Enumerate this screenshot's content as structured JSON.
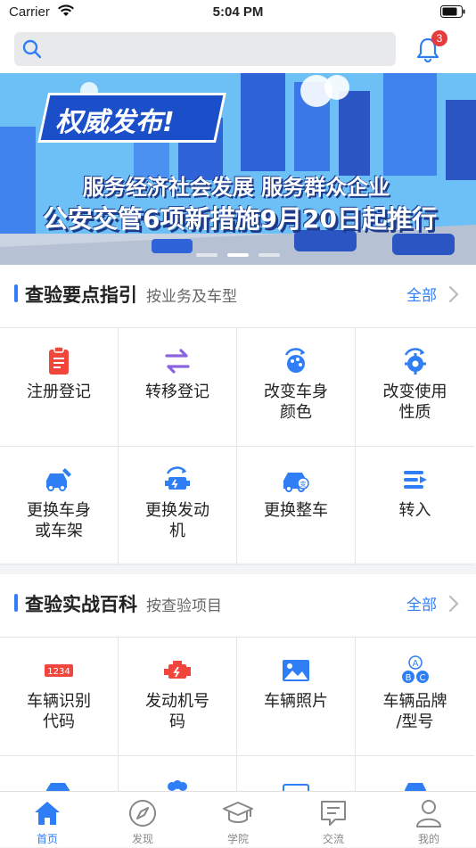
{
  "status_bar": {
    "carrier": "Carrier",
    "time": "5:04 PM"
  },
  "search": {
    "placeholder": "",
    "value": ""
  },
  "notifications": {
    "count": "3"
  },
  "banner": {
    "tag": "权威发布!",
    "line1": "服务经济社会发展 服务群众企业",
    "line2": "公安交管6项新措施9月20日起推行",
    "slide_count": 3,
    "active_slide": 2
  },
  "section1": {
    "title": "查验要点指引",
    "subtitle": "按业务及车型",
    "more": "全部",
    "items": [
      {
        "label": "注册登记",
        "icon": "clipboard-icon",
        "color": "#f0463c"
      },
      {
        "label": "转移登记",
        "icon": "transfer-arrows-icon",
        "color": "#8a63e0"
      },
      {
        "label": "改变车身\n颜色",
        "icon": "palette-icon",
        "color": "#2f7ef6"
      },
      {
        "label": "改变使用\n性质",
        "icon": "gear-refresh-icon",
        "color": "#2f7ef6"
      },
      {
        "label": "更换车身\n或车架",
        "icon": "car-wrench-icon",
        "color": "#2f7ef6"
      },
      {
        "label": "更换发动\n机",
        "icon": "engine-refresh-icon",
        "color": "#2f7ef6"
      },
      {
        "label": "更换整车",
        "icon": "car-swap-icon",
        "color": "#2f7ef6"
      },
      {
        "label": "转入",
        "icon": "transfer-in-icon",
        "color": "#2f7ef6"
      }
    ]
  },
  "section2": {
    "title": "查验实战百科",
    "subtitle": "按查验项目",
    "more": "全部",
    "items": [
      {
        "label": "车辆识别\n代码",
        "icon": "vin-code-icon",
        "color": "#f0463c",
        "code": "1234"
      },
      {
        "label": "发动机号\n码",
        "icon": "engine-icon",
        "color": "#f0463c"
      },
      {
        "label": "车辆照片",
        "icon": "photo-icon",
        "color": "#2f7ef6"
      },
      {
        "label": "车辆品牌\n/型号",
        "icon": "abc-icon",
        "color": "#2f7ef6"
      }
    ]
  },
  "tabs": [
    {
      "label": "首页",
      "icon": "home-icon",
      "active": true
    },
    {
      "label": "发现",
      "icon": "compass-icon",
      "active": false
    },
    {
      "label": "学院",
      "icon": "graduation-cap-icon",
      "active": false
    },
    {
      "label": "交流",
      "icon": "chat-icon",
      "active": false
    },
    {
      "label": "我的",
      "icon": "user-icon",
      "active": false
    }
  ],
  "colors": {
    "accent": "#2f7ef6",
    "badge": "#e63b3b"
  }
}
